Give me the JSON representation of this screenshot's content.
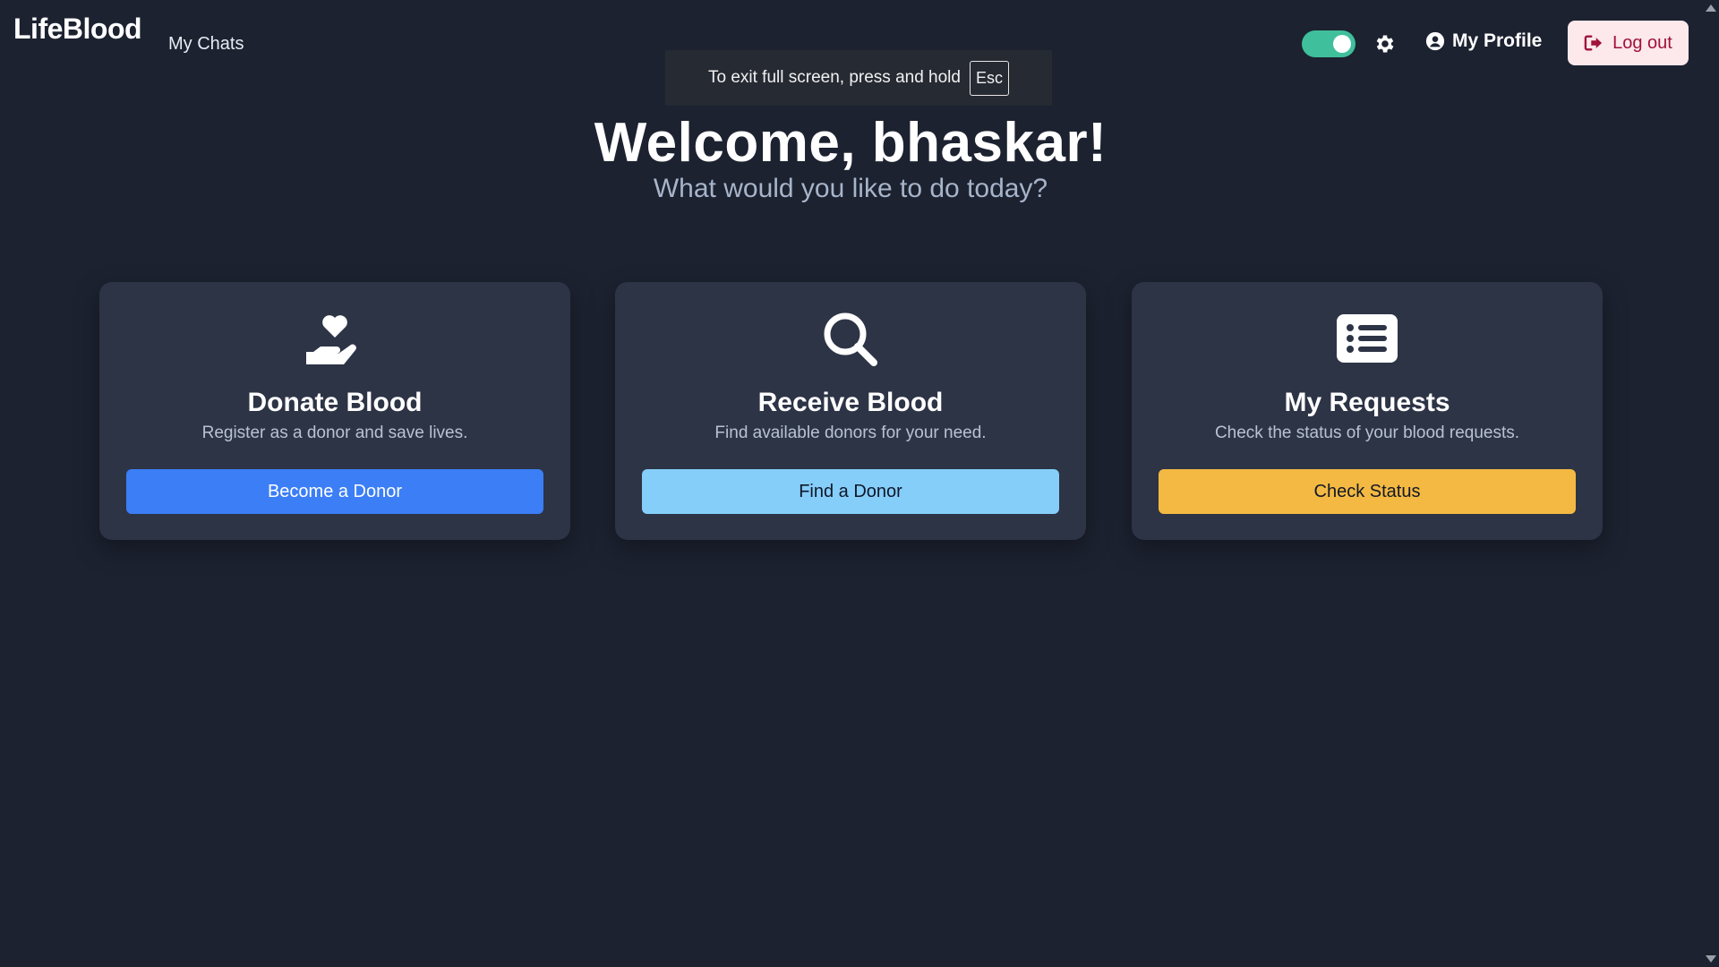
{
  "header": {
    "brand": "LifeBlood",
    "nav_chats": "My Chats",
    "profile_label": "My Profile",
    "logout_label": "Log out",
    "toggle_state": "on",
    "toggle_color": "#3fbf9b"
  },
  "fullscreen_notice": {
    "text": "To exit full screen, press and hold",
    "key": "Esc"
  },
  "hero": {
    "welcome": "Welcome, bhaskar!",
    "subtitle": "What would you like to do today?"
  },
  "cards": [
    {
      "icon": "hand-heart-icon",
      "title": "Donate Blood",
      "description": "Register as a donor and save lives.",
      "button": "Become a Donor",
      "button_color": "#3b7ef6"
    },
    {
      "icon": "search-icon",
      "title": "Receive Blood",
      "description": "Find available donors for your need.",
      "button": "Find a Donor",
      "button_color": "#86cefa"
    },
    {
      "icon": "list-icon",
      "title": "My Requests",
      "description": "Check the status of your blood requests.",
      "button": "Check Status",
      "button_color": "#f4b942"
    }
  ]
}
